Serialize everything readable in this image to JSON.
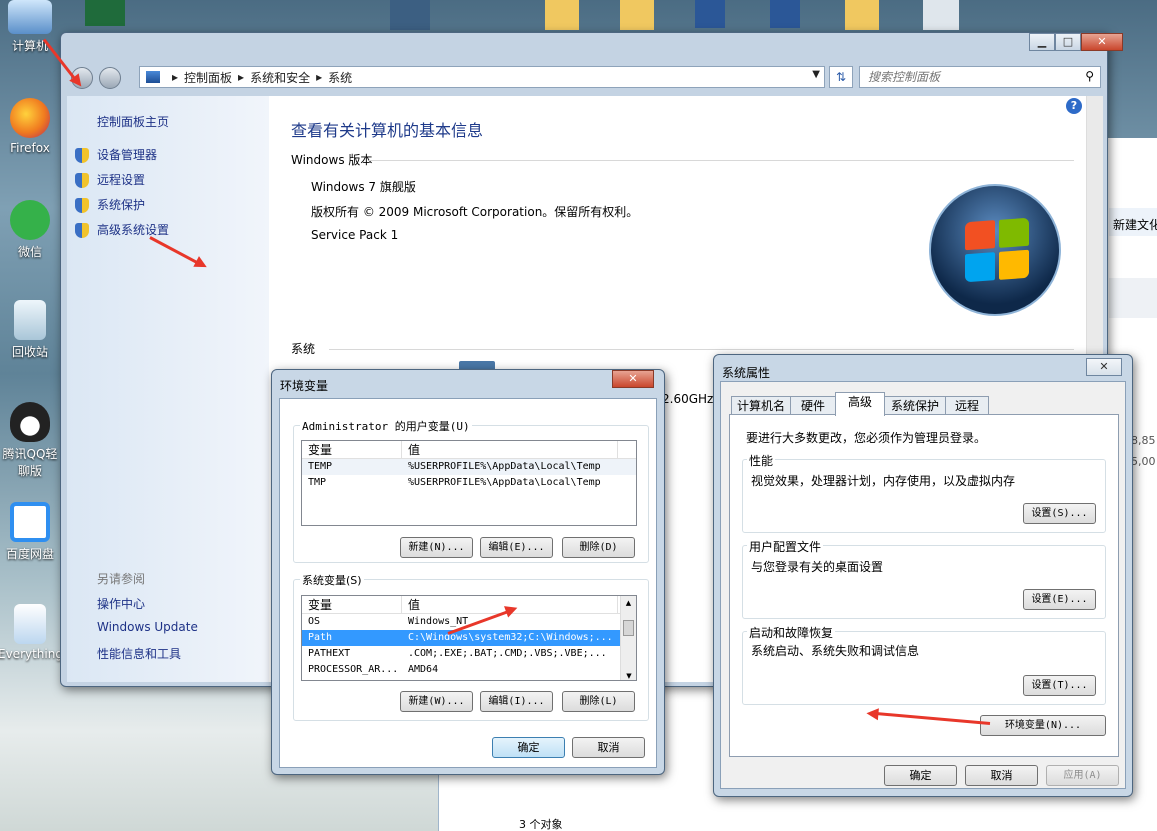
{
  "desktop": {
    "icons": [
      {
        "label": "计算机",
        "color": "#7fb3e6"
      },
      {
        "label": "Firefox",
        "color": "#f07a1f"
      },
      {
        "label": "微信",
        "color": "#35b14a"
      },
      {
        "label": "回收站",
        "color": "#cfe3ef"
      },
      {
        "label": "腾讯QQ轻聊版",
        "color": "#2d2d2d"
      },
      {
        "label": "百度网盘",
        "color": "#2f8ff0"
      },
      {
        "label": "Everything.",
        "color": "#dbeaf7"
      }
    ]
  },
  "explorer_bg": {
    "toolbar_text": "新建文化",
    "values": [
      "8,85",
      "5,00"
    ],
    "footer_text": "3 个对象"
  },
  "system_window": {
    "breadcrumb": [
      "控制面板",
      "系统和安全",
      "系统"
    ],
    "search_placeholder": "搜索控制面板",
    "sidebar": {
      "home": "控制面板主页",
      "items": [
        "设备管理器",
        "远程设置",
        "系统保护",
        "高级系统设置"
      ],
      "see_also_title": "另请参阅",
      "see_also": [
        "操作中心",
        "Windows Update",
        "性能信息和工具"
      ]
    },
    "main": {
      "title": "查看有关计算机的基本信息",
      "edition_heading": "Windows 版本",
      "edition": "Windows 7 旗舰版",
      "copyright": "版权所有 © 2009 Microsoft Corporation。保留所有权利。",
      "service_pack": "Service Pack 1",
      "system_heading": "系统",
      "partial_cpu": "2.60GHz"
    },
    "help": "?"
  },
  "env_dialog": {
    "title": "环境变量",
    "user_group": "Administrator 的用户变量(U)",
    "col_var": "变量",
    "col_val": "值",
    "user_vars": [
      {
        "name": "TEMP",
        "value": "%USERPROFILE%\\AppData\\Local\\Temp"
      },
      {
        "name": "TMP",
        "value": "%USERPROFILE%\\AppData\\Local\\Temp"
      }
    ],
    "user_buttons": [
      "新建(N)...",
      "编辑(E)...",
      "删除(D)"
    ],
    "sys_group": "系统变量(S)",
    "sys_vars": [
      {
        "name": "OS",
        "value": "Windows_NT"
      },
      {
        "name": "Path",
        "value": "C:\\Windows\\system32;C:\\Windows;..."
      },
      {
        "name": "PATHEXT",
        "value": ".COM;.EXE;.BAT;.CMD;.VBS;.VBE;..."
      },
      {
        "name": "PROCESSOR_AR...",
        "value": "AMD64"
      }
    ],
    "sys_buttons": [
      "新建(W)...",
      "编辑(I)...",
      "删除(L)"
    ],
    "ok": "确定",
    "cancel": "取消"
  },
  "sysprop_dialog": {
    "title": "系统属性",
    "tabs": [
      "计算机名",
      "硬件",
      "高级",
      "系统保护",
      "远程"
    ],
    "admin_note": "要进行大多数更改，您必须作为管理员登录。",
    "perf": {
      "title": "性能",
      "desc": "视觉效果，处理器计划，内存使用，以及虚拟内存",
      "button": "设置(S)..."
    },
    "profile": {
      "title": "用户配置文件",
      "desc": "与您登录有关的桌面设置",
      "button": "设置(E)..."
    },
    "startup": {
      "title": "启动和故障恢复",
      "desc": "系统启动、系统失败和调试信息",
      "button": "设置(T)..."
    },
    "env_button": "环境变量(N)...",
    "ok": "确定",
    "cancel": "取消",
    "apply": "应用(A)"
  }
}
